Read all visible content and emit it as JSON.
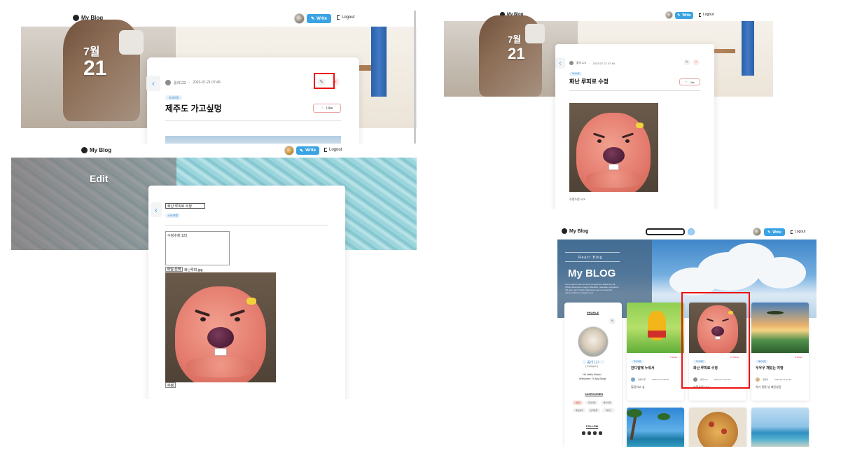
{
  "header": {
    "logo": "My Blog",
    "write": "Write",
    "logout": "Logout"
  },
  "detail_post": {
    "month": "7월",
    "day": "21",
    "author": "롤리123",
    "datetime": "2023-07-21 07:49",
    "category": "국내여행",
    "title": "제주도 가고싶멍",
    "like": "Like"
  },
  "edit_post": {
    "heading": "Edit",
    "title_value": "화난 루피로 수정",
    "category": "국내여행",
    "content_value": "수정수정 123",
    "file_button": "파일 선택",
    "file_name": "화난루피.jpg",
    "submit": "수정"
  },
  "updated_post": {
    "month": "7월",
    "day": "21",
    "author": "롤리123",
    "datetime": "2023-07-21 07:49",
    "category": "국내여행",
    "title": "화난 루피로 수정",
    "like": "Like",
    "content": "수정수정 123"
  },
  "home": {
    "hero_subtitle": "React Blog",
    "hero_title": "My BLOG",
    "hero_text": "Lorem ipsum dolor sit amet consectetur adipiscing elit. Officiis laboriosam magni. Blanditiis molestiae voluptatum. Vel quis, iste? Facilis. Maecenas ipsum a eiusmod dolorum laborum aliquam sed.",
    "profile_label": "PROFILE",
    "profile_name": "롤리123",
    "profile_id": "( tnmup4 )",
    "greeting_1": "Hi! Hello World",
    "greeting_2": "Welcome To My Blog!",
    "categories_label": "CATEGORIES",
    "categories": [
      "전체",
      "국내여행",
      "해외여행",
      "개발공부",
      "반려동물",
      "재테크"
    ],
    "follow_label": "FOLLOW",
    "posts": [
      {
        "category": "국내여행",
        "views": "0 Views",
        "title": "잔디밭에 누워서",
        "author": "곰돌이푸",
        "datetime": "2023-07-21 08:38",
        "excerpt": "힐링하고 싶"
      },
      {
        "category": "국내여행",
        "views": "11 Views",
        "title": "화난 루피로 수정",
        "author": "롤리123",
        "datetime": "2023-07-21 07:49",
        "excerpt": "수정수정 123"
      },
      {
        "category": "해외여행",
        "views": "0 Views",
        "title": "우우우 재밌는 여행",
        "author": "행행이",
        "datetime": "2023-07-21 07:34",
        "excerpt": "하기 정말 날 재밌었음"
      }
    ]
  }
}
